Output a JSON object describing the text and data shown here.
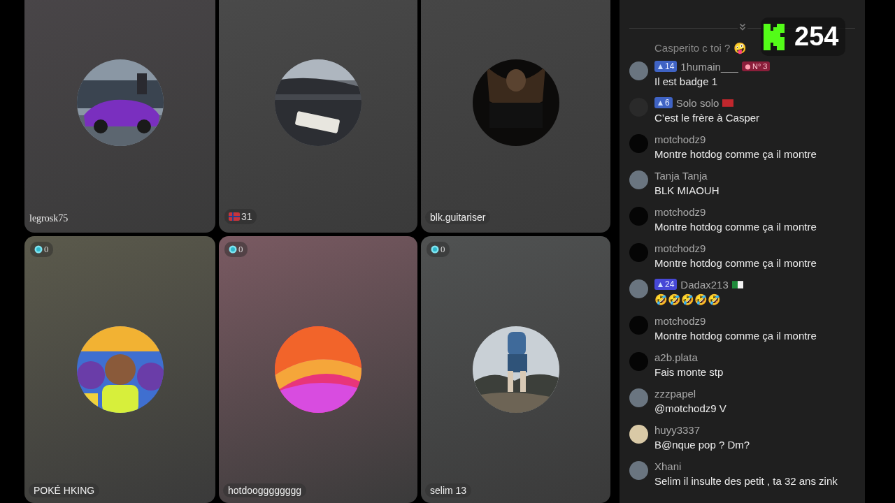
{
  "tiles": [
    {
      "color": "#4a4649",
      "name": "legrosk75",
      "name_pill": false
    },
    {
      "color": "#4b4b4b",
      "counter": {
        "value": "31",
        "kind": "flag"
      }
    },
    {
      "color": "#474747",
      "name": "blk.guitariser",
      "name_pill": true
    },
    {
      "color": "#5b5a4c",
      "name": "POKÉ HKING",
      "name_pill": true,
      "counter": {
        "value": "0",
        "kind": "gem"
      }
    },
    {
      "color": "#7a5a62",
      "name": "hotdoogggggggg",
      "name_pill": true,
      "counter": {
        "value": "0",
        "kind": "gem"
      }
    },
    {
      "color": "#505252",
      "name": "selim 13",
      "name_pill": true,
      "counter": {
        "value": "0",
        "kind": "gem"
      }
    }
  ],
  "chat": {
    "pinned": {
      "text": "Casperito c toi ? 🤪"
    },
    "messages": [
      {
        "user": "1humain___",
        "level": {
          "value": "14",
          "color": "#3f63c4"
        },
        "rank": "N° 3",
        "text": "Il est badge 1"
      },
      {
        "user": "Solo solo",
        "avatar": {
          "kind": "empty"
        },
        "level": {
          "value": "6",
          "color": "#3f63c4"
        },
        "flag": {
          "kind": "red"
        },
        "text": "C’est le frère à Casper"
      },
      {
        "user": "motchodz9",
        "avatar": {
          "kind": "dark"
        },
        "text": "Montre hotdog comme ça il montre"
      },
      {
        "user": "Tanja Tanja",
        "text": "BLK MIAOUH"
      },
      {
        "user": "motchodz9",
        "avatar": {
          "kind": "dark"
        },
        "text": "Montre hotdog comme ça il montre"
      },
      {
        "user": "motchodz9",
        "avatar": {
          "kind": "dark"
        },
        "text": "Montre hotdog comme ça il montre"
      },
      {
        "user": "Dadax213",
        "level": {
          "value": "24",
          "color": "#4748d6"
        },
        "flag": {
          "kind": "green-white"
        },
        "text": "🤣🤣🤣🤣🤣"
      },
      {
        "user": "motchodz9",
        "avatar": {
          "kind": "dark"
        },
        "text": "Montre hotdog comme ça il montre"
      },
      {
        "user": "a2b.plata",
        "avatar": {
          "kind": "dark"
        },
        "text": "Fais monte stp"
      },
      {
        "user": "zzzpapel",
        "text": "@motchodz9 V"
      },
      {
        "user": "huyy3337",
        "avatar": {
          "kind": "light"
        },
        "text": "B@nque pop ? Dm?"
      },
      {
        "user": "Xhani",
        "text": "Selim il insulte des petit , ta 32 ans zink"
      }
    ]
  },
  "viewer_count": "254"
}
